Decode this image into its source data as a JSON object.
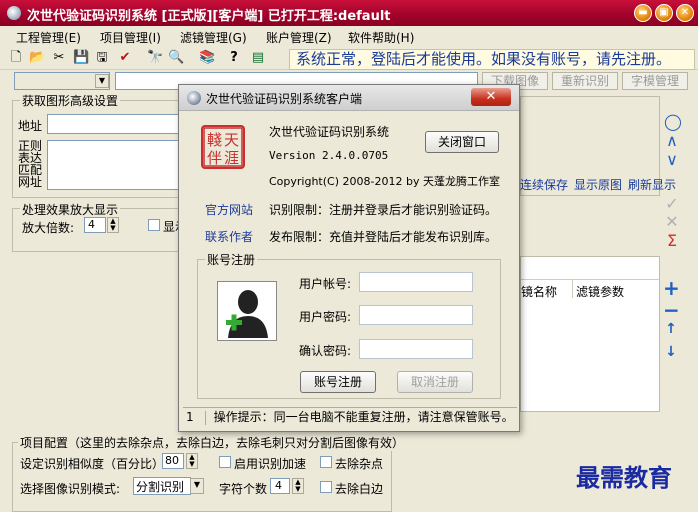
{
  "window": {
    "title": "次世代验证码识别系统 [正式版][客户端] 已打开工程:default",
    "minimize_glyph": "▬",
    "maximize_glyph": "▣",
    "close_glyph": "✕"
  },
  "menu": [
    "工程管理(E)",
    "项目管理(I)",
    "滤镜管理(G)",
    "账户管理(Z)",
    "软件帮助(H)"
  ],
  "toolbar": {
    "icons": [
      "new-file-icon",
      "open-folder-icon",
      "cut-icon",
      "save-icon",
      "save-as-icon",
      "checkmark-icon",
      "binoculars-icon",
      "binoculars-plus-icon",
      "books-icon",
      "help-pointer-icon",
      "chart-icon"
    ],
    "glyphs": [
      "🗋",
      "📂",
      "✂",
      "💾",
      "🖫",
      "✔",
      "🔭",
      "🔍",
      "📚",
      "?",
      "▤"
    ],
    "status": "系统正常，登陆后才能使用。如果没有账号，请先注册。"
  },
  "row2": {
    "download_image": "下载图像",
    "re_recognize": "重新识别",
    "font_manage": "字模管理"
  },
  "left_panel": {
    "group_title": "获取图形高级设置",
    "address_label": "地址",
    "regex_label": "正则\n表达\n匹配\n网址",
    "zoom_group": "处理效果放大显示",
    "zoom_label": "放大倍数:",
    "zoom_value": "4",
    "show_checkbox": "显示"
  },
  "right_panel": {
    "links": [
      "连续保存",
      "显示原图",
      "刷新显示"
    ],
    "table_headers": [
      "镜名称",
      "滤镜参数"
    ],
    "side_icons_top": [
      "circle-icon",
      "chevron-up-icon",
      "chevron-down-icon"
    ],
    "side_glyphs_top": [
      "◯",
      "∧",
      "∨"
    ],
    "side_icons_mid": [
      "check-icon",
      "cross-icon",
      "sigma-icon"
    ],
    "side_glyphs_mid": [
      "✓",
      "✕",
      "Σ"
    ],
    "side_icons_bottom": [
      "plus-icon",
      "minus-icon",
      "arrow-up-icon",
      "arrow-down-icon"
    ],
    "side_glyphs_bottom": [
      "+",
      "−",
      "↑",
      "↓"
    ]
  },
  "project_config": {
    "title": "项目配置（这里的去除杂点，去除白边，去除毛刺只对分割后图像有效）",
    "similarity_label": "设定识别相似度（百分比）:",
    "similarity_value": "80",
    "enable_accel": "启用识别加速",
    "remove_noise": "去除杂点",
    "mode_label": "选择图像识别模式:",
    "mode_value": "分割识别",
    "char_count_label": "字符个数",
    "char_count_value": "4",
    "remove_border": "去除白边"
  },
  "dialog": {
    "title": "次世代验证码识别系统客户端",
    "close_glyph": "✕",
    "logo_text": "轅天伴",
    "app_name": "次世代验证码识别系统",
    "close_window": "关闭窗口",
    "version": "Version 2.4.0.0705",
    "copyright": "Copyright(C) 2008-2012 by 天蓬龙腾工作室",
    "official_site": "官方网站",
    "contact_author": "联系作者",
    "recognition_limit": "识别限制：注册并登录后才能识别验证码。",
    "publish_limit": "发布限制：充值并登陆后才能发布识别库。",
    "account_group": "账号注册",
    "user_account": "用户帐号:",
    "user_password": "用户密码:",
    "confirm_password": "确认密码:",
    "register_button": "账号注册",
    "cancel_register": "取消注册",
    "status_index": "1",
    "status_text": "操作提示：同一台电脑不能重复注册，请注意保管账号。"
  },
  "watermark": "最需教育"
}
